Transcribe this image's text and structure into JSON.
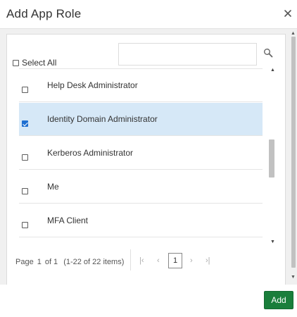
{
  "dialog": {
    "title": "Add App Role",
    "close_icon": "close-icon"
  },
  "filter": {
    "select_all_label": "Select All",
    "select_all_checked": false,
    "search_value": "",
    "search_placeholder": "",
    "search_icon": "search-icon"
  },
  "roles": [
    {
      "label": "Help Desk Administrator",
      "checked": false,
      "selected": false
    },
    {
      "label": "Identity Domain Administrator",
      "checked": true,
      "selected": true
    },
    {
      "label": "Kerberos Administrator",
      "checked": false,
      "selected": false
    },
    {
      "label": "Me",
      "checked": false,
      "selected": false
    },
    {
      "label": "MFA Client",
      "checked": false,
      "selected": false
    }
  ],
  "pagination": {
    "page_label": "Page",
    "current_page": "1",
    "of_label": "of 1",
    "items_label": "(1-22 of 22 items)",
    "first_icon": "first-page-icon",
    "prev_icon": "previous-page-icon",
    "next_icon": "next-page-icon",
    "last_icon": "last-page-icon",
    "page_button": "1"
  },
  "footer": {
    "add_label": "Add"
  },
  "colors": {
    "selected_row": "#d6e8f7",
    "add_button": "#1a7e3b",
    "checkbox_checked": "#1f6fd1"
  }
}
